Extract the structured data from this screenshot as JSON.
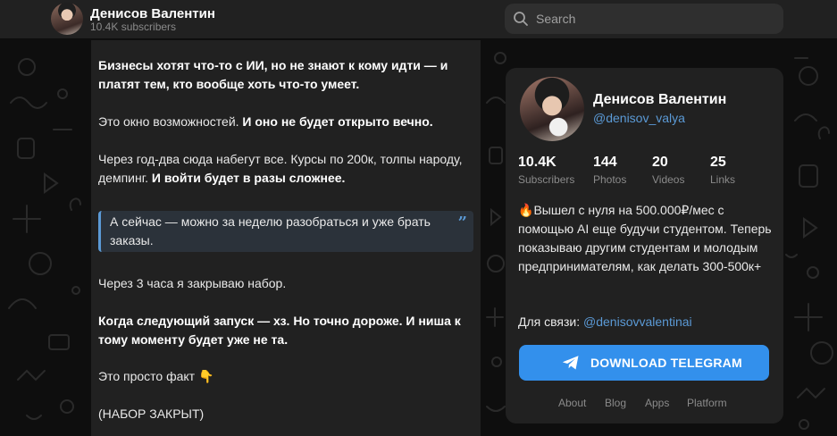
{
  "header": {
    "channel_name": "Денисов Валентин",
    "subscribers": "10.4K subscribers",
    "search_placeholder": "Search"
  },
  "post": {
    "paragraphs": [
      "Бизнесы хотят что-то с ИИ, но не знают к кому идти — и платят тем, кто вообще хоть что-то умеет.",
      "Это окно возможностей. И оно не будет открыто вечно.",
      "Через год-два сюда набегут все. Курсы по 200к, толпы народу, демпинг. ",
      "И войти будет в разы сложнее.",
      "Через 3 часа я закрываю набор.",
      "Когда следующий запуск — хз. Но точно дороже. И ниша к тому моменту будет уже не та.",
      "Это просто факт 👇",
      "(НАБОР ЗАКРЫТ)"
    ],
    "quote": "А сейчас — можно за неделю разобраться и уже брать заказы."
  },
  "channel_card": {
    "name": "Денисов Валентин",
    "handle": "@denisov_valya",
    "stats": [
      {
        "value": "10.4K",
        "label": "Subscribers"
      },
      {
        "value": "144",
        "label": "Photos"
      },
      {
        "value": "20",
        "label": "Videos"
      },
      {
        "value": "25",
        "label": "Links"
      }
    ],
    "description_emoji": "🔥",
    "description": "Вышел с нуля на 500.000₽/мес с помощью AI еще будучи студентом. Теперь показываю другим студентам и молодым предпринимателям, как делать 300-500к+",
    "contact_label": "Для связи: ",
    "contact_link": "@denisovvalentinai",
    "download_button": "DOWNLOAD TELEGRAM",
    "footer_links": [
      "About",
      "Blog",
      "Apps",
      "Platform"
    ]
  },
  "colors": {
    "accent": "#3390ec",
    "link": "#5b9ad6",
    "card_bg": "#212121",
    "page_bg": "#0f0f0f"
  }
}
